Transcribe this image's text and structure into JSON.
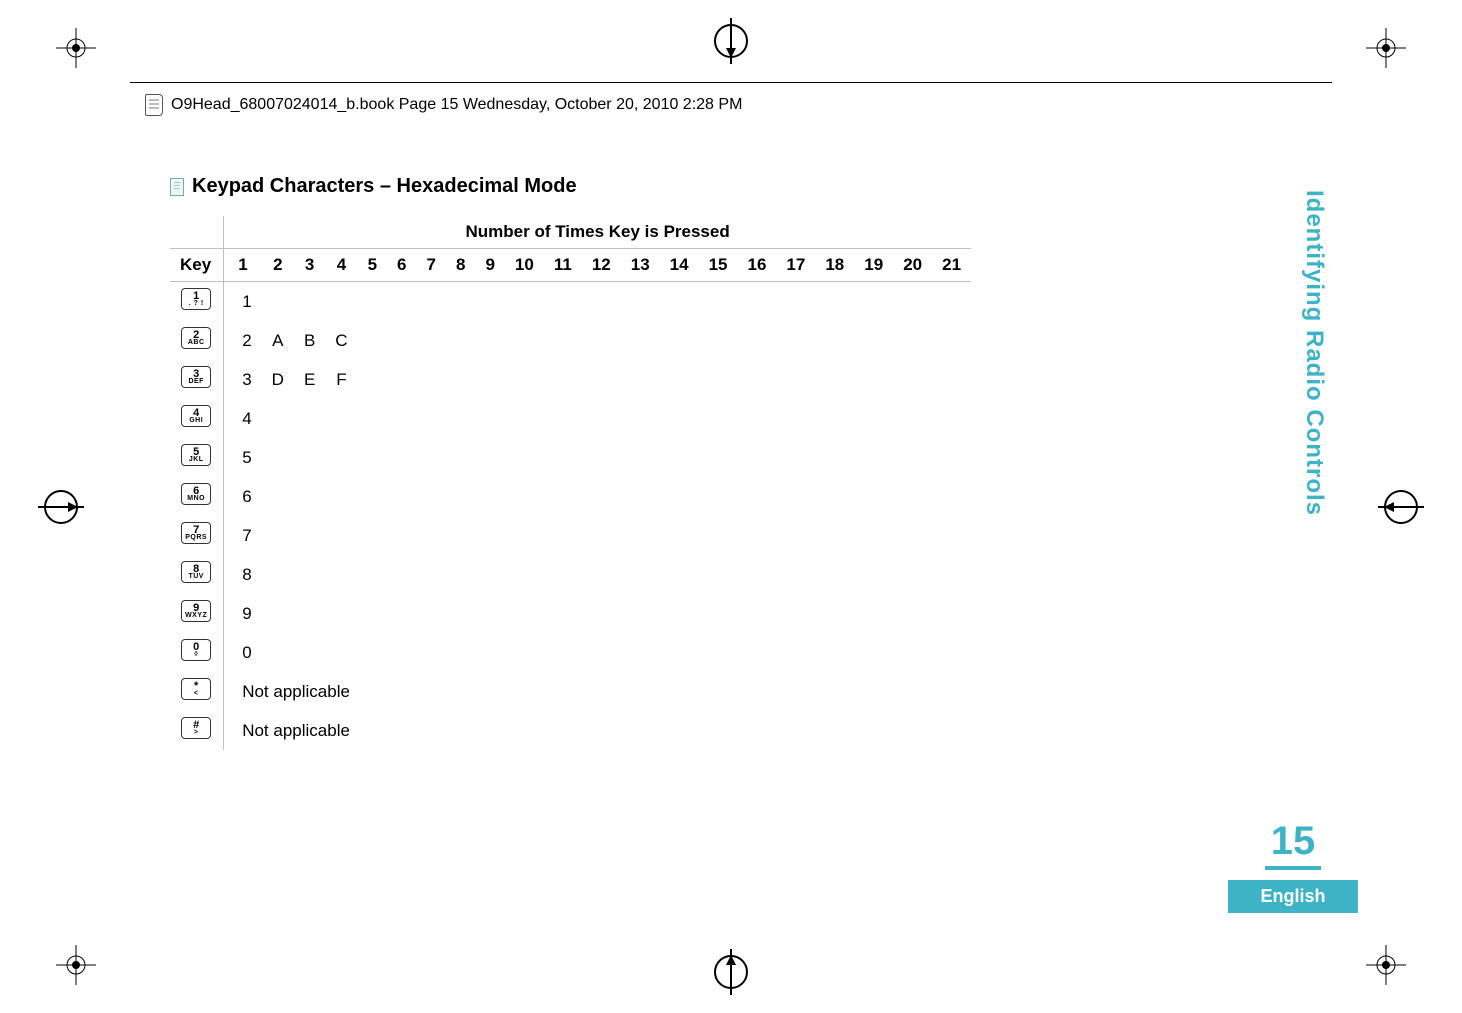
{
  "running_header": {
    "text": "O9Head_68007024014_b.book  Page 15  Wednesday, October 20, 2010  2:28 PM"
  },
  "section_heading": "Keypad Characters – Hexadecimal Mode",
  "table": {
    "key_label": "Key",
    "group_header": "Number of Times Key is Pressed",
    "columns": [
      "1",
      "2",
      "3",
      "4",
      "5",
      "6",
      "7",
      "8",
      "9",
      "10",
      "11",
      "12",
      "13",
      "14",
      "15",
      "16",
      "17",
      "18",
      "19",
      "20",
      "21"
    ],
    "rows": [
      {
        "key_main": "1",
        "key_sub": ". ? !",
        "cells": [
          "1"
        ]
      },
      {
        "key_main": "2",
        "key_sub": "ABC",
        "cells": [
          "2",
          "A",
          "B",
          "C"
        ]
      },
      {
        "key_main": "3",
        "key_sub": "DEF",
        "cells": [
          "3",
          "D",
          "E",
          "F"
        ]
      },
      {
        "key_main": "4",
        "key_sub": "GHI",
        "cells": [
          "4"
        ]
      },
      {
        "key_main": "5",
        "key_sub": "JKL",
        "cells": [
          "5"
        ]
      },
      {
        "key_main": "6",
        "key_sub": "MNO",
        "cells": [
          "6"
        ]
      },
      {
        "key_main": "7",
        "key_sub": "PQRS",
        "cells": [
          "7"
        ]
      },
      {
        "key_main": "8",
        "key_sub": "TUV",
        "cells": [
          "8"
        ]
      },
      {
        "key_main": "9",
        "key_sub": "WXYZ",
        "cells": [
          "9"
        ]
      },
      {
        "key_main": "0",
        "key_sub": "◊",
        "cells": [
          "0"
        ]
      },
      {
        "key_main": "*",
        "key_sub": "<",
        "cells_full": "Not applicable"
      },
      {
        "key_main": "#",
        "key_sub": ">",
        "cells_full": "Not applicable"
      }
    ]
  },
  "side_tab": "Identifying Radio Controls",
  "page_number": "15",
  "page_language": "English",
  "colors": {
    "accent": "#3fb3c6",
    "rule": "#bfbfbf"
  }
}
